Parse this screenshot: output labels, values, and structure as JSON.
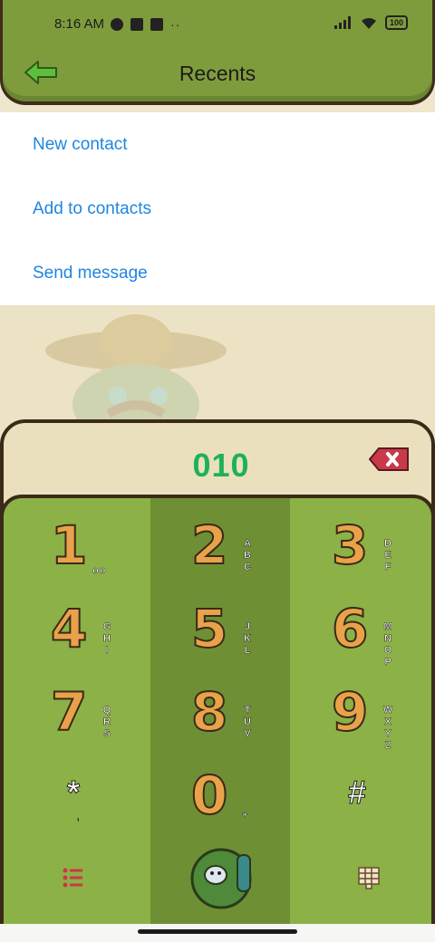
{
  "status_bar": {
    "time": "8:16 AM",
    "battery": "100"
  },
  "header": {
    "title": "Recents"
  },
  "menu": {
    "items": [
      {
        "label": "New contact"
      },
      {
        "label": "Add to contacts"
      },
      {
        "label": "Send message"
      }
    ]
  },
  "dialer": {
    "number": "010"
  },
  "keypad": {
    "keys": [
      {
        "digit": "1",
        "letters": "oo"
      },
      {
        "digit": "2",
        "letters": "ABC"
      },
      {
        "digit": "3",
        "letters": "DEF"
      },
      {
        "digit": "4",
        "letters": "GHI"
      },
      {
        "digit": "5",
        "letters": "JKL"
      },
      {
        "digit": "6",
        "letters": "MNOP"
      },
      {
        "digit": "7",
        "letters": "QRS"
      },
      {
        "digit": "8",
        "letters": "TUV"
      },
      {
        "digit": "9",
        "letters": "WXYZ"
      },
      {
        "symbol": "*",
        "sub": ","
      },
      {
        "digit": "0",
        "letters": "+"
      },
      {
        "symbol": "#"
      }
    ]
  },
  "colors": {
    "accent_link": "#1f86e0",
    "number_green": "#1fb05a",
    "header_green": "#7f9c3d",
    "keypad_green": "#8cb146"
  },
  "icons": {
    "back": "green-arrow-left-icon",
    "delete": "red-delete-tag-icon",
    "menu": "list-menu-icon",
    "call": "cactus-call-icon",
    "keypad_toggle": "grid-keypad-icon"
  }
}
